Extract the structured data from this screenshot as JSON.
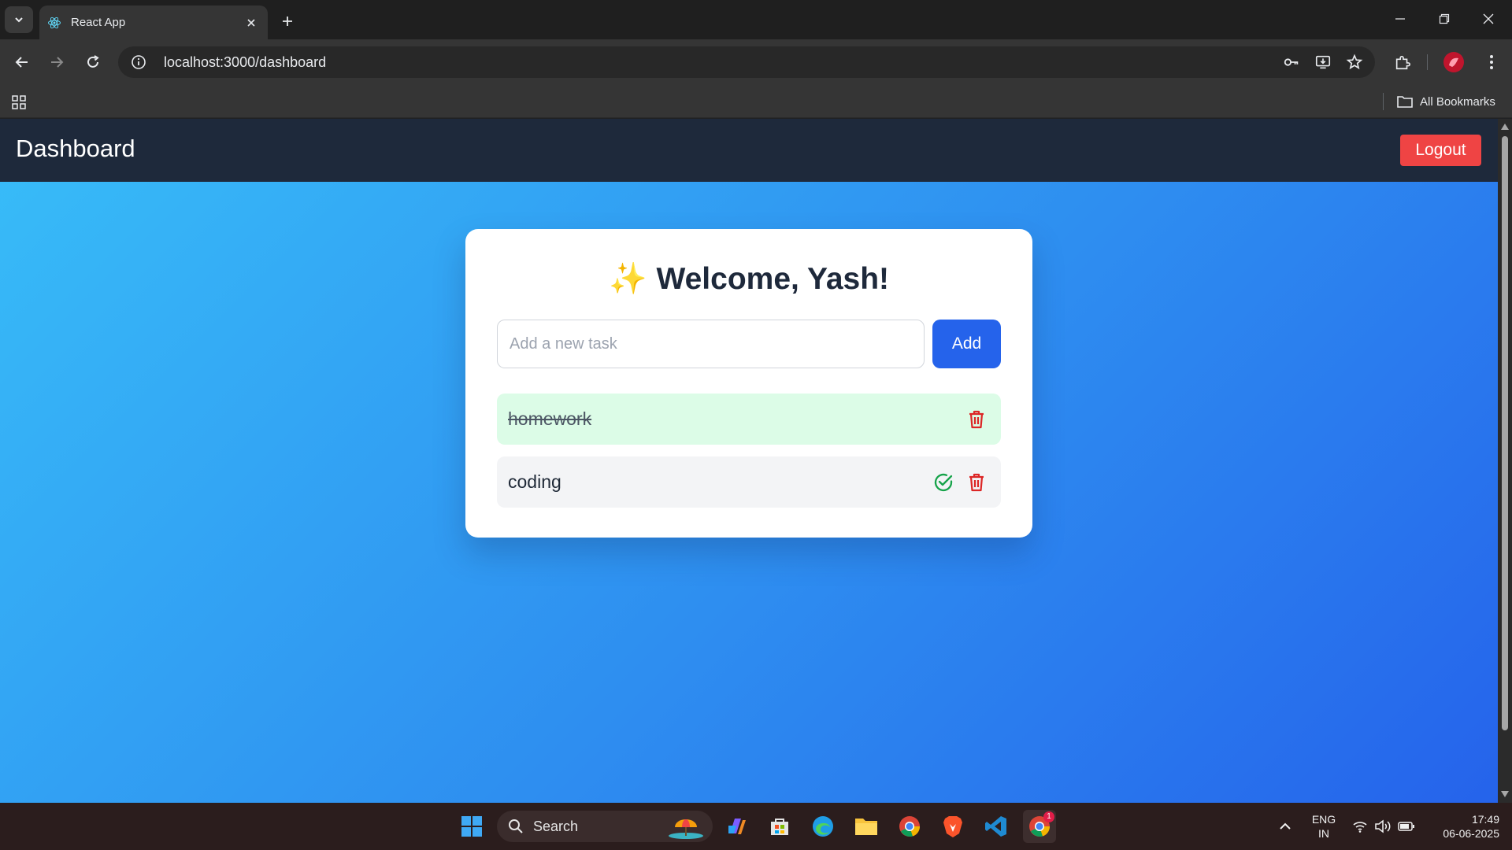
{
  "browser": {
    "tab_title": "React App",
    "url": "localhost:3000/dashboard",
    "bookmarks_label": "All Bookmarks"
  },
  "app": {
    "title": "Dashboard",
    "logout_label": "Logout",
    "welcome_text": "Welcome, Yash!",
    "welcome_emoji": "✨",
    "input": {
      "placeholder": "Add a new task",
      "value": ""
    },
    "add_label": "Add",
    "tasks": [
      {
        "text": "homework",
        "completed": true
      },
      {
        "text": "coding",
        "completed": false
      }
    ]
  },
  "taskbar": {
    "search_label": "Search",
    "lang": "ENG",
    "region": "IN",
    "time": "17:49",
    "date": "06-06-2025",
    "notification_count": "1"
  },
  "colors": {
    "header_bg": "#1e293b",
    "logout": "#ef4444",
    "add_button": "#2563eb",
    "completed_task_bg": "#dcfce7",
    "check_icon": "#16a34a",
    "trash_icon": "#dc2626"
  }
}
